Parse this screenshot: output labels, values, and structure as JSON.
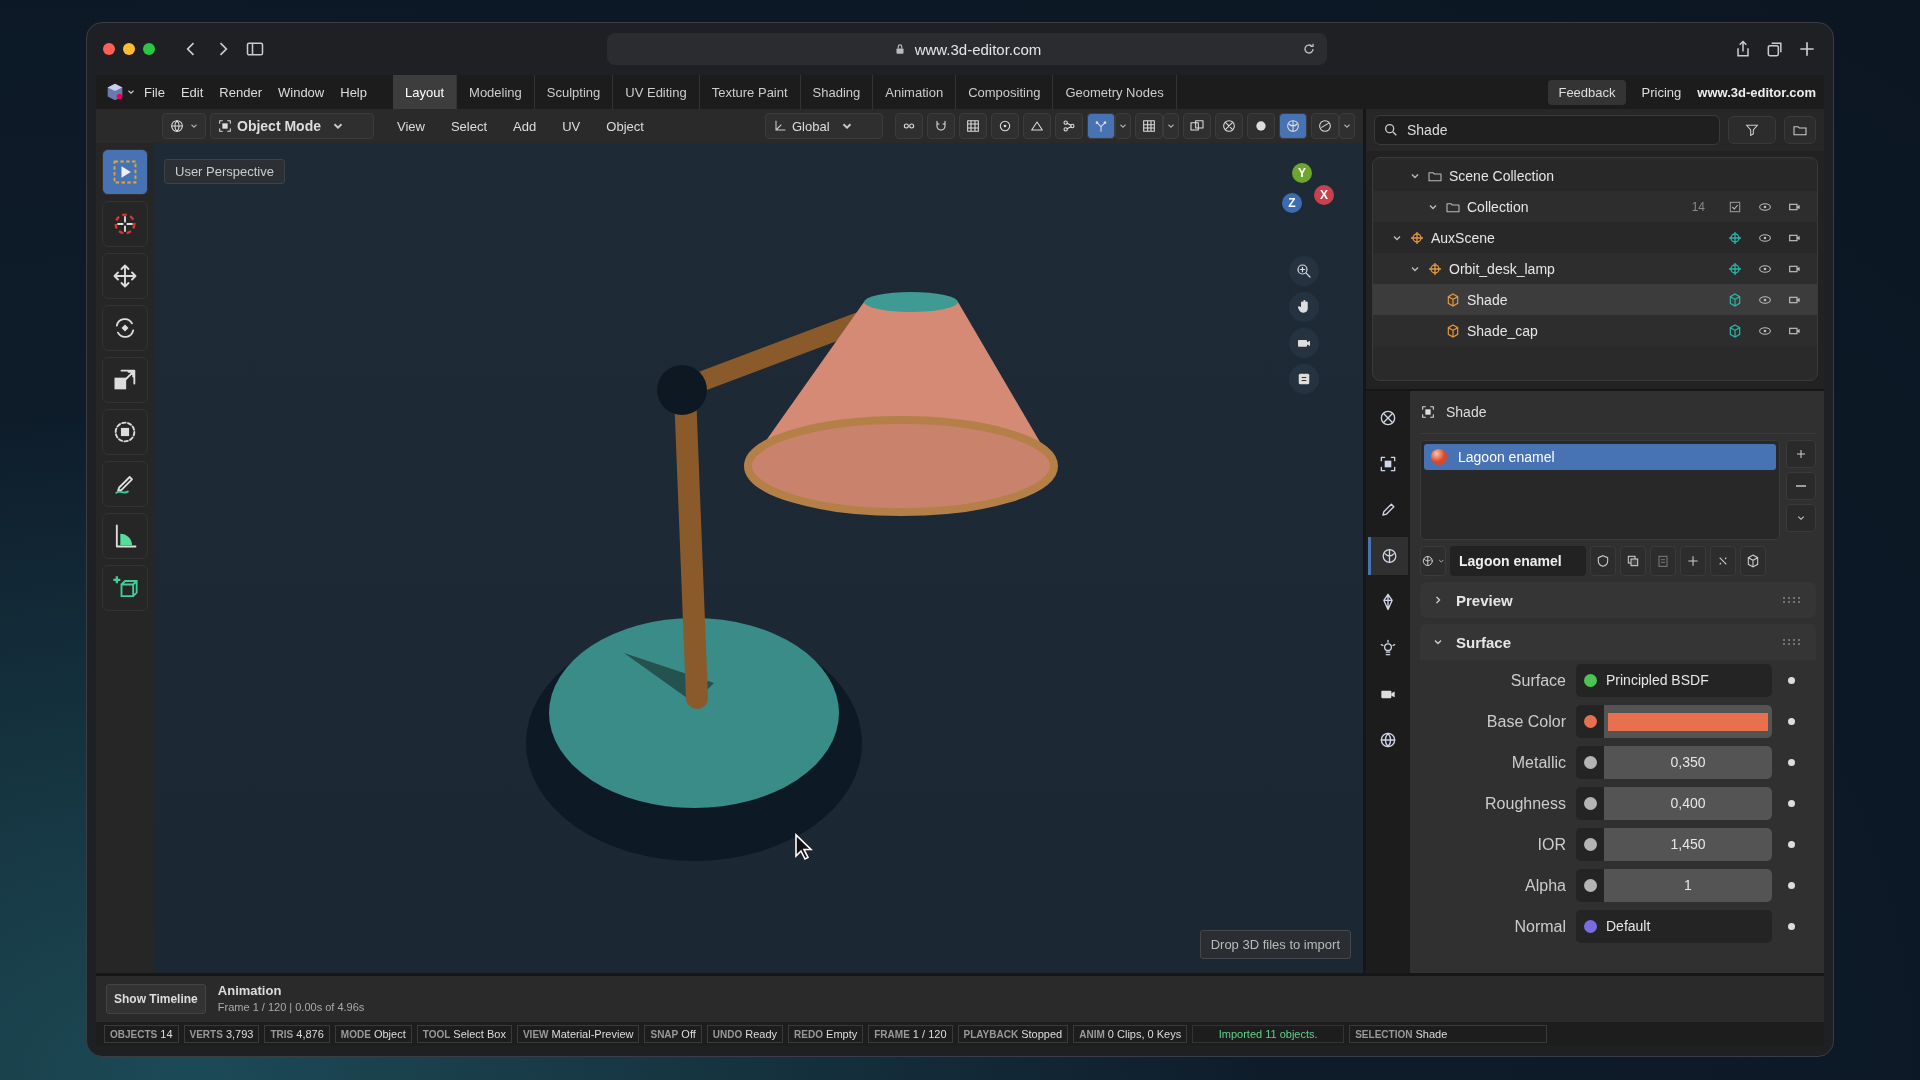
{
  "browser": {
    "url": "www.3d-editor.com"
  },
  "menu": [
    "File",
    "Edit",
    "Render",
    "Window",
    "Help"
  ],
  "workspaces": [
    {
      "label": "Layout",
      "selected": true
    },
    {
      "label": "Modeling",
      "selected": false
    },
    {
      "label": "Sculpting",
      "selected": false
    },
    {
      "label": "UV Editing",
      "selected": false
    },
    {
      "label": "Texture Paint",
      "selected": false
    },
    {
      "label": "Shading",
      "selected": false
    },
    {
      "label": "Animation",
      "selected": false
    },
    {
      "label": "Compositing",
      "selected": false
    },
    {
      "label": "Geometry Nodes",
      "selected": false
    }
  ],
  "top_right": {
    "feedback": "Feedback",
    "pricing": "Pricing",
    "site": "www.3d-editor.com"
  },
  "viewport_header": {
    "mode": "Object Mode",
    "menus": [
      "View",
      "Select",
      "Add",
      "UV",
      "Object"
    ],
    "orientation": "Global",
    "toggles": [
      {
        "kind": "link",
        "selected": false,
        "caret": false
      },
      {
        "kind": "magnet",
        "selected": false,
        "caret": false
      },
      {
        "kind": "grid",
        "selected": false,
        "caret": false
      },
      {
        "kind": "pivot",
        "selected": false,
        "caret": false
      },
      {
        "kind": "falloff",
        "selected": false,
        "caret": false
      },
      {
        "kind": "nodes",
        "selected": false,
        "caret": false
      },
      {
        "kind": "gizmo",
        "selected": true,
        "caret": true
      },
      {
        "kind": "overlay",
        "selected": false,
        "caret": true
      },
      {
        "kind": "xray",
        "selected": false,
        "caret": false
      },
      {
        "kind": "wireframe",
        "selected": false,
        "caret": false
      },
      {
        "kind": "solid",
        "selected": false,
        "caret": false
      },
      {
        "kind": "material",
        "selected": true,
        "caret": false
      },
      {
        "kind": "rendered",
        "selected": false,
        "caret": true
      }
    ]
  },
  "tools": [
    {
      "kind": "select-box",
      "selected": true
    },
    {
      "kind": "cursor",
      "selected": false
    },
    {
      "kind": "move",
      "selected": false
    },
    {
      "kind": "rotate",
      "selected": false
    },
    {
      "kind": "scale",
      "selected": false
    },
    {
      "kind": "transform",
      "selected": false
    },
    {
      "kind": "annotate",
      "selected": false
    },
    {
      "kind": "measure",
      "selected": false
    },
    {
      "kind": "add-cube",
      "selected": false
    }
  ],
  "viewport": {
    "label": "User Perspective",
    "axes": [
      {
        "label": "Y",
        "color": "#6ca62c"
      },
      {
        "label": "X",
        "color": "#c8414f"
      },
      {
        "label": "Z",
        "color": "#3b6cb3"
      }
    ],
    "nav": [
      {
        "kind": "zoom"
      },
      {
        "kind": "pan"
      },
      {
        "kind": "camera"
      },
      {
        "kind": "ortho"
      }
    ],
    "drop_hint": "Drop 3D files to import"
  },
  "outliner": {
    "search": "Shade",
    "tree": [
      {
        "name": "Scene Collection",
        "kind": "collection",
        "expanded": true,
        "selected": false,
        "children": [
          {
            "name": "Collection",
            "kind": "collection",
            "expanded": true,
            "selected": false,
            "count": "14",
            "checked": true
          }
        ]
      },
      {
        "name": "AuxScene",
        "kind": "empty",
        "expanded": true,
        "selected": false,
        "children": [
          {
            "name": "Orbit_desk_lamp",
            "kind": "empty",
            "expanded": true,
            "selected": false,
            "children": [
              {
                "name": "Shade",
                "kind": "mesh",
                "selected": true
              },
              {
                "name": "Shade_cap",
                "kind": "mesh",
                "selected": false
              }
            ]
          }
        ]
      }
    ]
  },
  "properties": {
    "tabs": [
      {
        "kind": "scene",
        "selected": false
      },
      {
        "kind": "object",
        "selected": false
      },
      {
        "kind": "modifier",
        "selected": false
      },
      {
        "kind": "material",
        "selected": true
      },
      {
        "kind": "data",
        "selected": false
      },
      {
        "kind": "light",
        "selected": false
      },
      {
        "kind": "camera",
        "selected": false
      },
      {
        "kind": "world",
        "selected": false
      }
    ],
    "object": "Shade",
    "slots": [
      {
        "name": "Lagoon enamel",
        "selected": true
      }
    ],
    "material": "Lagoon enamel",
    "panels": [
      {
        "title": "Preview",
        "expanded": false
      },
      {
        "title": "Surface",
        "expanded": true,
        "inputs": [
          {
            "label": "Surface",
            "kind": "shader",
            "color": "#4cc355",
            "value": "Principled BSDF"
          },
          {
            "label": "Base Color",
            "kind": "color",
            "color": "#e8704f"
          },
          {
            "label": "Metallic",
            "kind": "value",
            "color": "#b4b4b4",
            "value": "0,350"
          },
          {
            "label": "Roughness",
            "kind": "value",
            "color": "#b4b4b4",
            "value": "0,400"
          },
          {
            "label": "IOR",
            "kind": "value",
            "color": "#b4b4b4",
            "value": "1,450"
          },
          {
            "label": "Alpha",
            "kind": "value",
            "color": "#b4b4b4",
            "value": "1"
          },
          {
            "label": "Normal",
            "kind": "vector",
            "color": "#7a6ce0",
            "value": "Default"
          }
        ]
      }
    ]
  },
  "timeline": {
    "button": "Show Timeline",
    "title": "Animation",
    "info": "Frame 1 / 120 | 0.00s of 4.96s"
  },
  "status": [
    {
      "kind": "stat",
      "key": "OBJECTS",
      "value": "14"
    },
    {
      "kind": "stat",
      "key": "VERTS",
      "value": "3,793"
    },
    {
      "kind": "stat",
      "key": "TRIS",
      "value": "4,876"
    },
    {
      "kind": "stat",
      "key": "MODE",
      "value": "Object"
    },
    {
      "kind": "stat",
      "key": "TOOL",
      "value": "Select Box"
    },
    {
      "kind": "stat",
      "key": "VIEW",
      "value": "Material-Preview"
    },
    {
      "kind": "stat",
      "key": "SNAP",
      "value": "Off"
    },
    {
      "kind": "stat",
      "key": "UNDO",
      "value": "Ready"
    },
    {
      "kind": "stat",
      "key": "REDO",
      "value": "Empty"
    },
    {
      "kind": "stat",
      "key": "FRAME",
      "value": "1 / 120"
    },
    {
      "kind": "stat",
      "key": "PLAYBACK",
      "value": "Stopped"
    },
    {
      "kind": "stat",
      "key": "ANIM",
      "value": "0 Clips, 0 Keys"
    },
    {
      "kind": "message",
      "value": "Imported 11 objects."
    },
    {
      "kind": "stat",
      "key": "SELECTION",
      "value": "Shade"
    }
  ]
}
